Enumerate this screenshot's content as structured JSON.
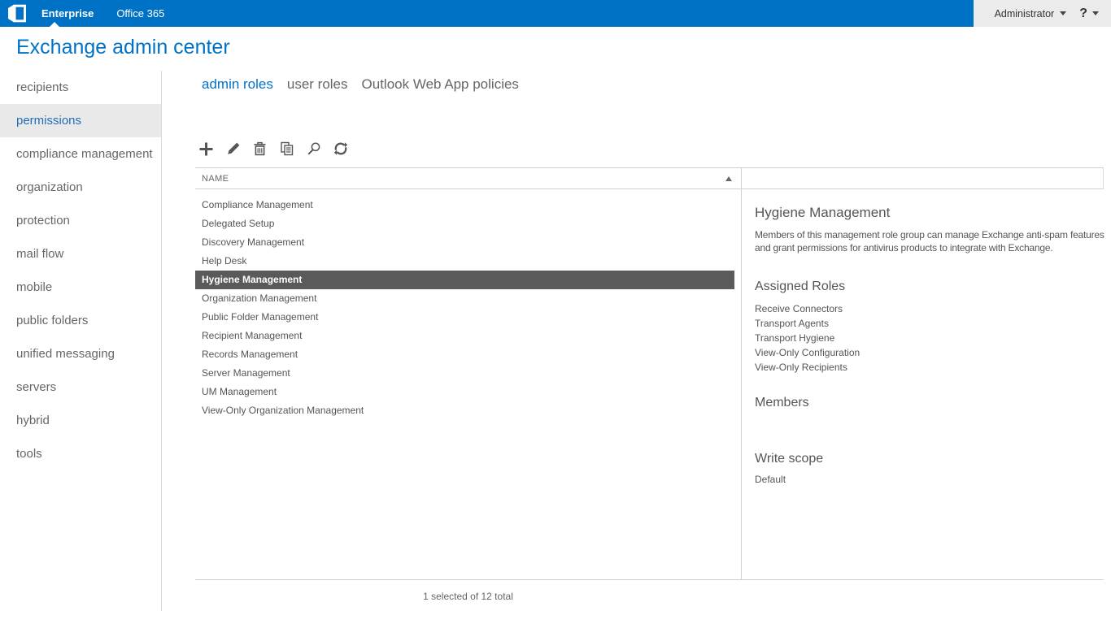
{
  "topbar": {
    "brand_tabs": [
      {
        "label": "Enterprise",
        "active": true
      },
      {
        "label": "Office 365",
        "active": false
      }
    ],
    "user_menu_label": "Administrator",
    "help_label": "?"
  },
  "page_title": "Exchange admin center",
  "sidebar": {
    "items": [
      {
        "label": "recipients",
        "selected": false
      },
      {
        "label": "permissions",
        "selected": true
      },
      {
        "label": "compliance management",
        "selected": false
      },
      {
        "label": "organization",
        "selected": false
      },
      {
        "label": "protection",
        "selected": false
      },
      {
        "label": "mail flow",
        "selected": false
      },
      {
        "label": "mobile",
        "selected": false
      },
      {
        "label": "public folders",
        "selected": false
      },
      {
        "label": "unified messaging",
        "selected": false
      },
      {
        "label": "servers",
        "selected": false
      },
      {
        "label": "hybrid",
        "selected": false
      },
      {
        "label": "tools",
        "selected": false
      }
    ]
  },
  "tabs": [
    {
      "label": "admin roles",
      "active": true
    },
    {
      "label": "user roles",
      "active": false
    },
    {
      "label": "Outlook Web App policies",
      "active": false
    }
  ],
  "toolbar": {
    "icons": [
      "add-icon",
      "edit-icon",
      "delete-icon",
      "copy-icon",
      "search-icon",
      "refresh-icon"
    ]
  },
  "table": {
    "columns": [
      {
        "label": "NAME",
        "sort": "ascending"
      }
    ],
    "rows": [
      {
        "name": "Compliance Management",
        "selected": false
      },
      {
        "name": "Delegated Setup",
        "selected": false
      },
      {
        "name": "Discovery Management",
        "selected": false
      },
      {
        "name": "Help Desk",
        "selected": false
      },
      {
        "name": "Hygiene Management",
        "selected": true
      },
      {
        "name": "Organization Management",
        "selected": false
      },
      {
        "name": "Public Folder Management",
        "selected": false
      },
      {
        "name": "Recipient Management",
        "selected": false
      },
      {
        "name": "Records Management",
        "selected": false
      },
      {
        "name": "Server Management",
        "selected": false
      },
      {
        "name": "UM Management",
        "selected": false
      },
      {
        "name": "View-Only Organization Management",
        "selected": false
      }
    ],
    "status": "1 selected of 12 total"
  },
  "details": {
    "title": "Hygiene Management",
    "description": "Members of this management role group can manage Exchange anti-spam features and grant permissions for antivirus products to integrate with Exchange.",
    "assigned_roles": {
      "heading": "Assigned Roles",
      "items": [
        "Receive Connectors",
        "Transport Agents",
        "Transport Hygiene",
        "View-Only Configuration",
        "View-Only Recipients"
      ]
    },
    "members": {
      "heading": "Members",
      "items": []
    },
    "write_scope": {
      "heading": "Write scope",
      "value": "Default"
    }
  },
  "colors": {
    "accent": "#0072c6",
    "topbar_background": "#0072c6",
    "topbar_right_background": "#ebebeb",
    "selected_row_background": "#5a5a5a",
    "selected_row_text": "#ffffff",
    "sidebar_selected_background": "#e9e9e9",
    "sidebar_selected_text": "#1f6cb5"
  }
}
